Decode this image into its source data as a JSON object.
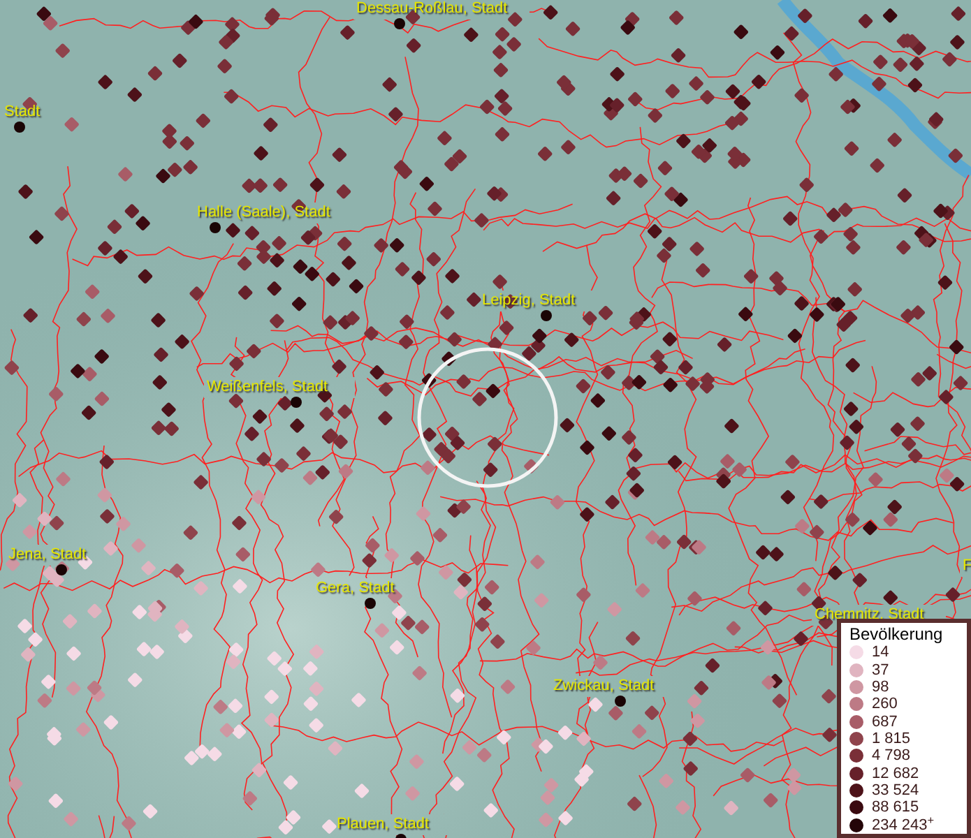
{
  "map": {
    "places": [
      {
        "label": "Dessau-Roßlau, Stadt"
      },
      {
        "label": "Stadt"
      },
      {
        "label": "Halle (Saale), Stadt"
      },
      {
        "label": "Leipzig, Stadt"
      },
      {
        "label": "Weißenfels, Stadt"
      },
      {
        "label": "Jena, Stadt"
      },
      {
        "label": "Gera, Stadt"
      },
      {
        "label": "Chemnitz, Stadt"
      },
      {
        "label": "Zwickau, Stadt"
      },
      {
        "label": "Plauen, Stadt"
      },
      {
        "label": "F"
      }
    ]
  },
  "legend": {
    "title": "Bevölkerung",
    "items": [
      {
        "label": "14",
        "color": "#f5dbe6"
      },
      {
        "label": "37",
        "color": "#e0b4c0"
      },
      {
        "label": "98",
        "color": "#cf97a2"
      },
      {
        "label": "260",
        "color": "#bd7a85"
      },
      {
        "label": "687",
        "color": "#a85c67"
      },
      {
        "label": "1 815",
        "color": "#8f434c"
      },
      {
        "label": "4 798",
        "color": "#7a2f38"
      },
      {
        "label": "12 682",
        "color": "#66202a"
      },
      {
        "label": "33 524",
        "color": "#4d1219"
      },
      {
        "label": "88 615",
        "color": "#3a0a10"
      },
      {
        "label": "234 243$^{+}$",
        "color": "#240508"
      }
    ]
  }
}
